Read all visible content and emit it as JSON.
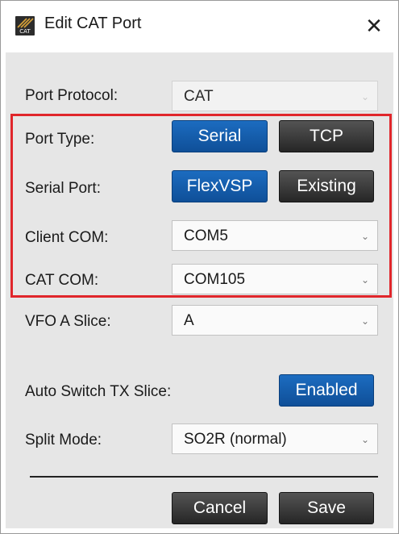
{
  "window": {
    "title": "Edit CAT Port",
    "icon_text": "CAT"
  },
  "form": {
    "port_protocol": {
      "label": "Port Protocol:",
      "value": "CAT"
    },
    "port_type": {
      "label": "Port Type:",
      "options": [
        "Serial",
        "TCP"
      ],
      "selected": "Serial"
    },
    "serial_port": {
      "label": "Serial Port:",
      "options": [
        "FlexVSP",
        "Existing"
      ],
      "selected": "FlexVSP"
    },
    "client_com": {
      "label": "Client COM:",
      "value": "COM5"
    },
    "cat_com": {
      "label": "CAT COM:",
      "value": "COM105"
    },
    "vfo_a_slice": {
      "label": "VFO A Slice:",
      "value": "A"
    },
    "auto_switch_tx_slice": {
      "label": "Auto Switch TX Slice:",
      "value": "Enabled"
    },
    "split_mode": {
      "label": "Split Mode:",
      "value": "SO2R (normal)"
    }
  },
  "footer": {
    "cancel_label": "Cancel",
    "save_label": "Save"
  },
  "colors": {
    "selected_button": "#1565b4",
    "unselected_button": "#3a3a3a",
    "highlight_box": "#e0262b",
    "dialog_background": "#e6e6e6"
  },
  "icons": {
    "close": "close-icon",
    "dropdown": "chevron-down-icon",
    "app": "cat-app-icon"
  }
}
